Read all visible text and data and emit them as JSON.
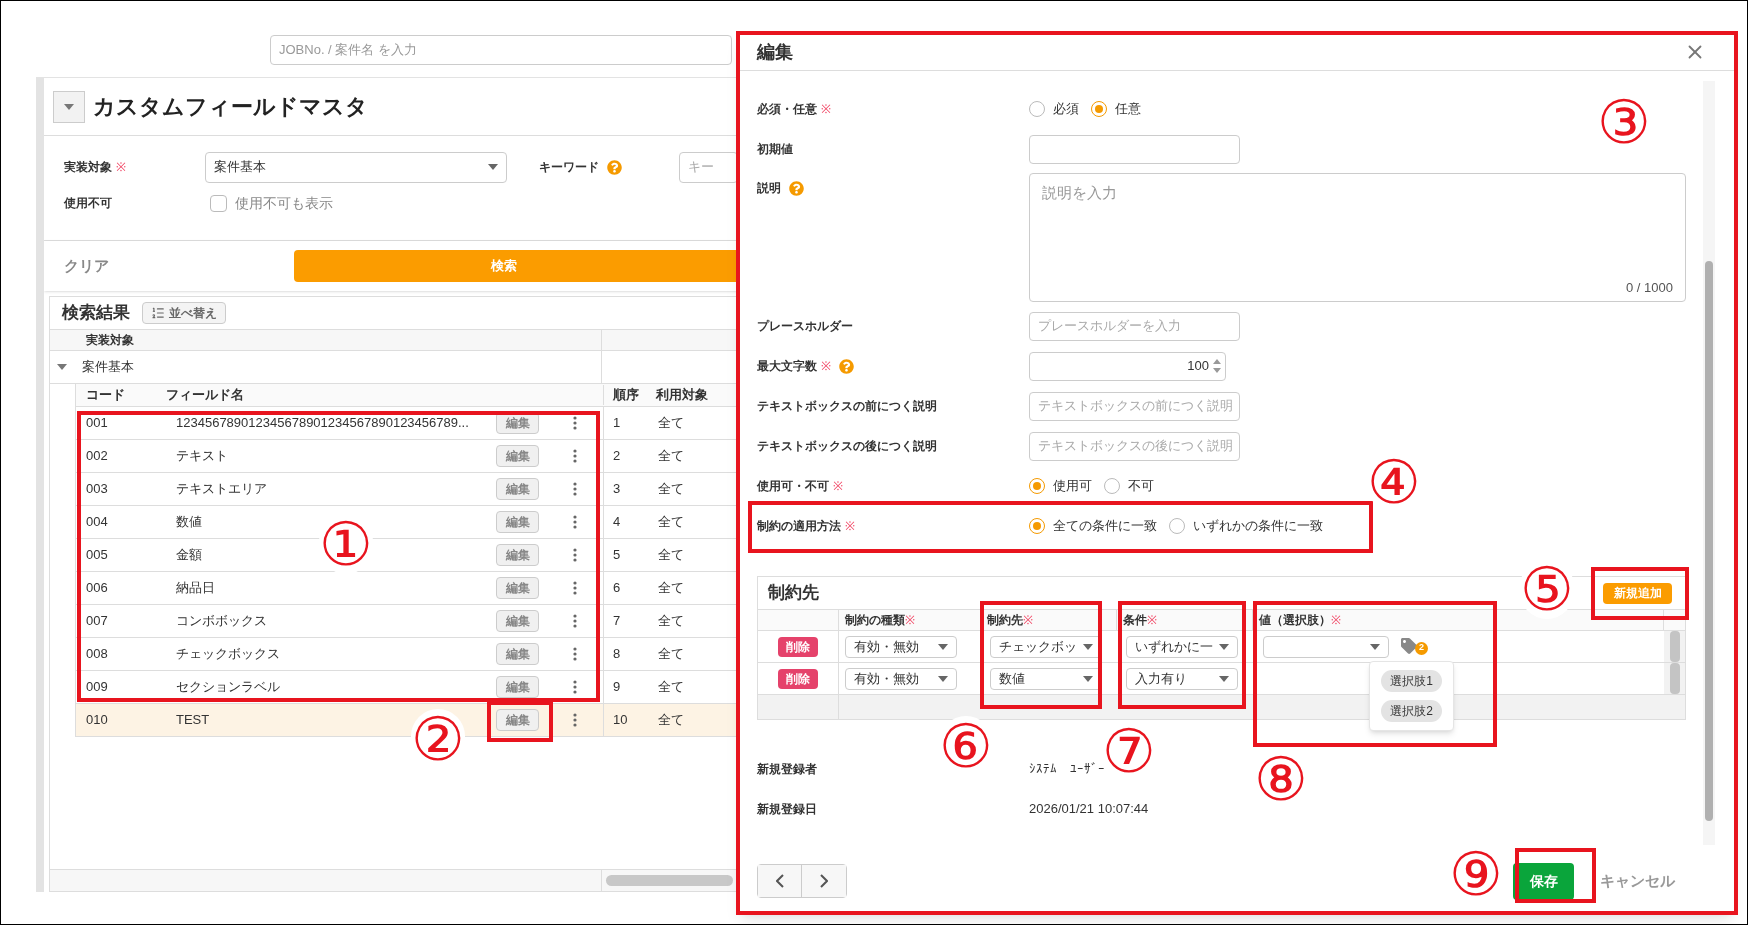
{
  "header_search": {
    "placeholder": "JOBNo. / 案件名 を入力"
  },
  "page": {
    "title": "カスタムフィールドマスタ",
    "expanded": true
  },
  "filters": {
    "target": {
      "label": "実装対象",
      "mark": "※",
      "value": "案件基本"
    },
    "keyword": {
      "label": "キーワード",
      "help": true,
      "placeholder": "キー"
    },
    "disabled": {
      "label": "使用不可",
      "checkbox_label": "使用不可も表示",
      "checked": false
    }
  },
  "actions": {
    "clear": "クリア",
    "search": "検索"
  },
  "results": {
    "title": "検索結果",
    "sort_button": "並べ替え",
    "group_header": "実装対象",
    "group": {
      "name": "案件基本",
      "expanded": true
    },
    "columns": [
      "コード",
      "フィールド名",
      "順序",
      "利用対象"
    ],
    "rows": [
      {
        "code": "001",
        "name": "123456789012345678901234567890123456789...",
        "edit": "編集",
        "order": "1",
        "target": "全て",
        "selected": false
      },
      {
        "code": "002",
        "name": "テキスト",
        "edit": "編集",
        "order": "2",
        "target": "全て",
        "selected": false
      },
      {
        "code": "003",
        "name": "テキストエリア",
        "edit": "編集",
        "order": "3",
        "target": "全て",
        "selected": false
      },
      {
        "code": "004",
        "name": "数値",
        "edit": "編集",
        "order": "4",
        "target": "全て",
        "selected": false
      },
      {
        "code": "005",
        "name": "金額",
        "edit": "編集",
        "order": "5",
        "target": "全て",
        "selected": false
      },
      {
        "code": "006",
        "name": "納品日",
        "edit": "編集",
        "order": "6",
        "target": "全て",
        "selected": false
      },
      {
        "code": "007",
        "name": "コンボボックス",
        "edit": "編集",
        "order": "7",
        "target": "全て",
        "selected": false
      },
      {
        "code": "008",
        "name": "チェックボックス",
        "edit": "編集",
        "order": "8",
        "target": "全て",
        "selected": false
      },
      {
        "code": "009",
        "name": "セクションラベル",
        "edit": "編集",
        "order": "9",
        "target": "全て",
        "selected": false
      },
      {
        "code": "010",
        "name": "TEST",
        "edit": "編集",
        "order": "10",
        "target": "全て",
        "selected": true
      }
    ]
  },
  "modal": {
    "title": "編集",
    "fields": [
      {
        "kind": "radio",
        "label": "必須・任意",
        "mark": "※",
        "options": [
          {
            "label": "必須",
            "selected": false
          },
          {
            "label": "任意",
            "selected": true
          }
        ]
      },
      {
        "kind": "text",
        "label": "初期値"
      },
      {
        "kind": "textarea",
        "label": "説明",
        "help": true,
        "placeholder": "説明を入力",
        "counter": "0 / 1000"
      },
      {
        "kind": "text",
        "label": "プレースホルダー",
        "placeholder": "プレースホルダーを入力"
      },
      {
        "kind": "number",
        "label": "最大文字数",
        "mark": "※",
        "help": true,
        "value": "100"
      },
      {
        "kind": "text",
        "label": "テキストボックスの前につく説明",
        "placeholder": "テキストボックスの前につく説明"
      },
      {
        "kind": "text",
        "label": "テキストボックスの後につく説明",
        "placeholder": "テキストボックスの後につく説明"
      },
      {
        "kind": "radio",
        "label": "使用可・不可",
        "mark": "※",
        "options": [
          {
            "label": "使用可",
            "selected": true
          },
          {
            "label": "不可",
            "selected": false
          }
        ]
      },
      {
        "kind": "radio",
        "label": "制約の適用方法",
        "mark": "※",
        "options": [
          {
            "label": "全ての条件に一致",
            "selected": true
          },
          {
            "label": "いずれかの条件に一致",
            "selected": false
          }
        ]
      }
    ],
    "constraints": {
      "title": "制約先",
      "add_button": "新規追加",
      "columns": [
        {
          "label": "制約の種類",
          "mark": "※"
        },
        {
          "label": "制約先",
          "mark": "※"
        },
        {
          "label": "条件",
          "mark": "※"
        },
        {
          "label": "値（選択肢）",
          "mark": "※"
        }
      ],
      "rows": [
        {
          "delete": "削除",
          "type": "有効・無効",
          "target": "チェックボッ",
          "condition": "いずれかに一",
          "has_value": true,
          "tag_count": "2",
          "choices": [
            "選択肢1",
            "選択肢2"
          ]
        },
        {
          "delete": "削除",
          "type": "有効・無効",
          "target": "数値",
          "condition": "入力有り",
          "has_value": false
        }
      ]
    },
    "meta": [
      {
        "label": "新規登録者",
        "value": "ｼｽﾃﾑ　ﾕｰｻﾞｰ"
      },
      {
        "label": "新規登録日",
        "value": "2026/01/21 10:07:44"
      }
    ],
    "save": "保存",
    "cancel": "キャンセル"
  },
  "callouts": [
    {
      "label": "①"
    },
    {
      "label": "②"
    },
    {
      "label": "③"
    },
    {
      "label": "④"
    },
    {
      "label": "⑤"
    },
    {
      "label": "⑥"
    },
    {
      "label": "⑦"
    },
    {
      "label": "⑧"
    },
    {
      "label": "⑨"
    }
  ]
}
